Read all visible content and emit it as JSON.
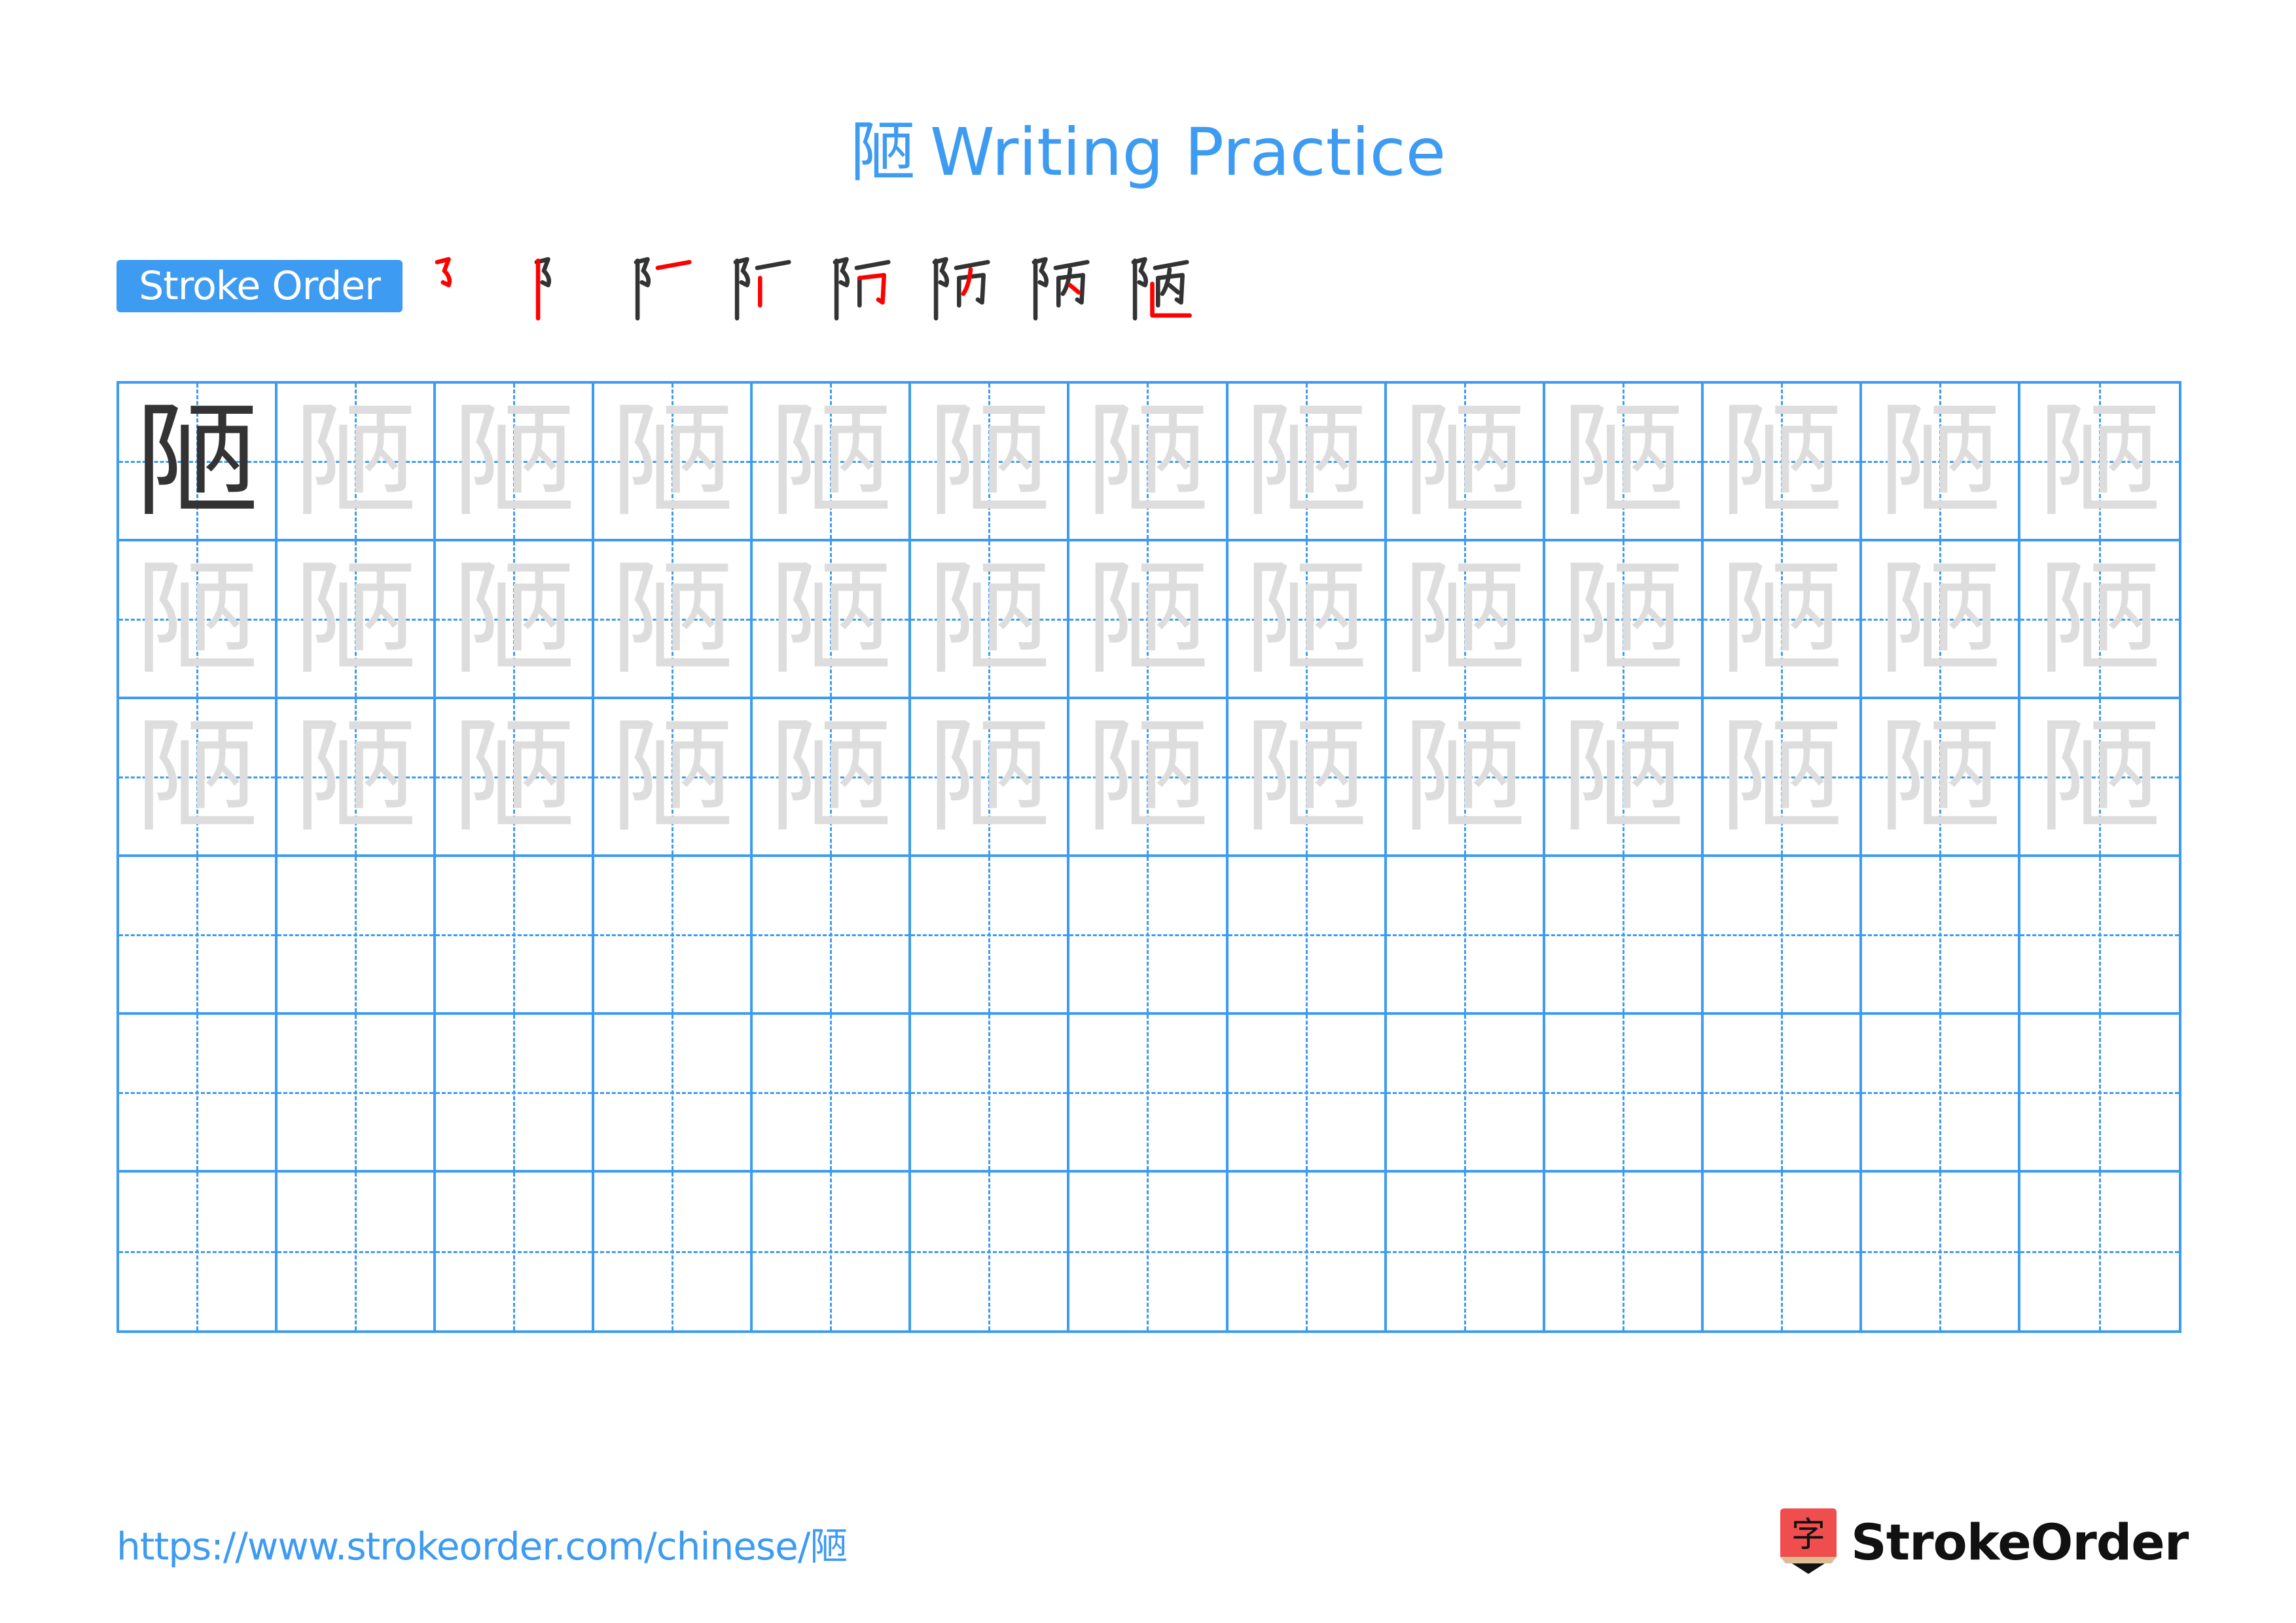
{
  "page": {
    "title_char": "陋",
    "title_text": "Writing Practice"
  },
  "stroke_order": {
    "badge_label": "Stroke Order",
    "total_strokes": 8,
    "steps": [
      {
        "step": 1,
        "label": "stroke-1"
      },
      {
        "step": 2,
        "label": "stroke-2"
      },
      {
        "step": 3,
        "label": "stroke-3"
      },
      {
        "step": 4,
        "label": "stroke-4"
      },
      {
        "step": 5,
        "label": "stroke-5"
      },
      {
        "step": 6,
        "label": "stroke-6"
      },
      {
        "step": 7,
        "label": "stroke-7"
      },
      {
        "step": 8,
        "label": "stroke-8"
      }
    ]
  },
  "grid": {
    "character": "陋",
    "columns": 13,
    "rows": 6,
    "model_cells": 1,
    "trace_rows": 3,
    "empty_rows": 3
  },
  "footer": {
    "url": "https://www.strokeorder.com/chinese/陋",
    "logo_glyph": "字",
    "logo_text": "StrokeOrder"
  },
  "colors": {
    "accent": "#3d9bf2",
    "model_glyph": "#333333",
    "trace_glyph": "#dddddd",
    "stroke_highlight": "#ff0000",
    "logo_red": "#f04e4e",
    "logo_tan": "#e0bc94"
  }
}
